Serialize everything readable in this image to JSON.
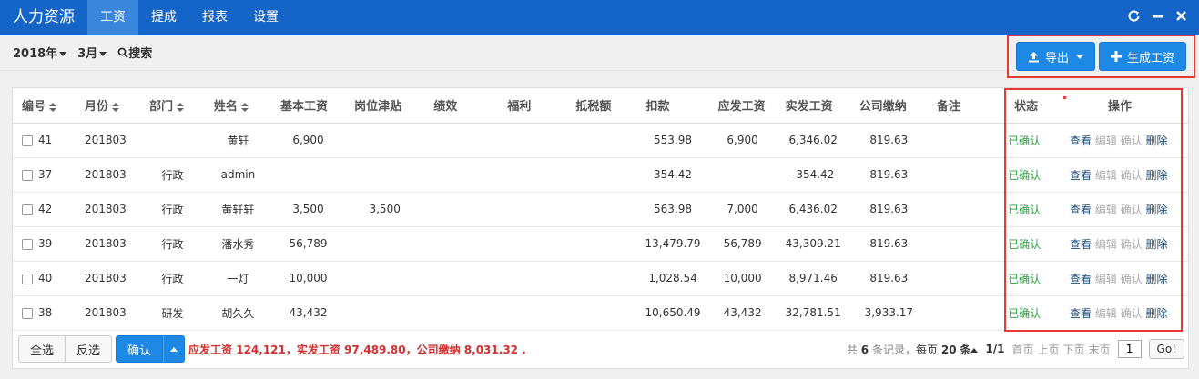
{
  "topbar": {
    "brand": "人力资源",
    "nav": [
      "工资",
      "提成",
      "报表",
      "设置"
    ],
    "active_index": 0,
    "controls": [
      "C",
      "—",
      "✖"
    ]
  },
  "toolbar": {
    "year": "2018年",
    "month": "3月",
    "search": "搜索",
    "export": "导出",
    "generate": "生成工资"
  },
  "table": {
    "headers": [
      "编号",
      "月份",
      "部门",
      "姓名",
      "基本工资",
      "岗位津贴",
      "绩效",
      "福利",
      "抵税额",
      "扣款",
      "应发工资",
      "实发工资",
      "公司缴纳",
      "备注",
      "状态",
      "操作"
    ],
    "rows": [
      {
        "id": "41",
        "month": "201803",
        "dept": "",
        "name": "黄轩",
        "base": "6,900",
        "allowance": "",
        "perf": "",
        "welfare": "",
        "tax": "",
        "deduct": "553.98",
        "payable": "6,900",
        "net": "6,346.02",
        "company": "819.63",
        "note": "",
        "status": "已确认"
      },
      {
        "id": "37",
        "month": "201803",
        "dept": "行政",
        "name": "admin",
        "base": "",
        "allowance": "",
        "perf": "",
        "welfare": "",
        "tax": "",
        "deduct": "354.42",
        "payable": "",
        "net": "-354.42",
        "company": "819.63",
        "note": "",
        "status": "已确认"
      },
      {
        "id": "42",
        "month": "201803",
        "dept": "行政",
        "name": "黄轩轩",
        "base": "3,500",
        "allowance": "3,500",
        "perf": "",
        "welfare": "",
        "tax": "",
        "deduct": "563.98",
        "payable": "7,000",
        "net": "6,436.02",
        "company": "819.63",
        "note": "",
        "status": "已确认"
      },
      {
        "id": "39",
        "month": "201803",
        "dept": "行政",
        "name": "潘水秀",
        "base": "56,789",
        "allowance": "",
        "perf": "",
        "welfare": "",
        "tax": "",
        "deduct": "13,479.79",
        "payable": "56,789",
        "net": "43,309.21",
        "company": "819.63",
        "note": "",
        "status": "已确认"
      },
      {
        "id": "40",
        "month": "201803",
        "dept": "行政",
        "name": "一灯",
        "base": "10,000",
        "allowance": "",
        "perf": "",
        "welfare": "",
        "tax": "",
        "deduct": "1,028.54",
        "payable": "10,000",
        "net": "8,971.46",
        "company": "819.63",
        "note": "",
        "status": "已确认"
      },
      {
        "id": "38",
        "month": "201803",
        "dept": "研发",
        "name": "胡久久",
        "base": "43,432",
        "allowance": "",
        "perf": "",
        "welfare": "",
        "tax": "",
        "deduct": "10,650.49",
        "payable": "43,432",
        "net": "32,781.51",
        "company": "3,933.17",
        "note": "",
        "status": "已确认"
      }
    ],
    "ops": [
      "查看",
      "编辑",
      "确认",
      "删除"
    ]
  },
  "footer": {
    "select_all": "全选",
    "invert": "反选",
    "confirm": "确认",
    "summary": "应发工资 124,121，实发工资 97,489.80，公司缴纳 8,031.32 .",
    "total_prefix": "共",
    "total_count": "6",
    "total_suffix": "条记录，",
    "per_page_prefix": "每页",
    "per_page": "20",
    "per_page_suffix": "条",
    "page_info": "1/1",
    "first": "首页",
    "prev": "上页",
    "next": "下页",
    "last": "末页",
    "page_input": "1",
    "go": "Go!"
  },
  "colors": {
    "topbar": "#1565c9",
    "primary": "#1e88e5",
    "status_green": "#2ea043",
    "highlight_red": "#e53935",
    "summary_red": "#d32f2f"
  }
}
